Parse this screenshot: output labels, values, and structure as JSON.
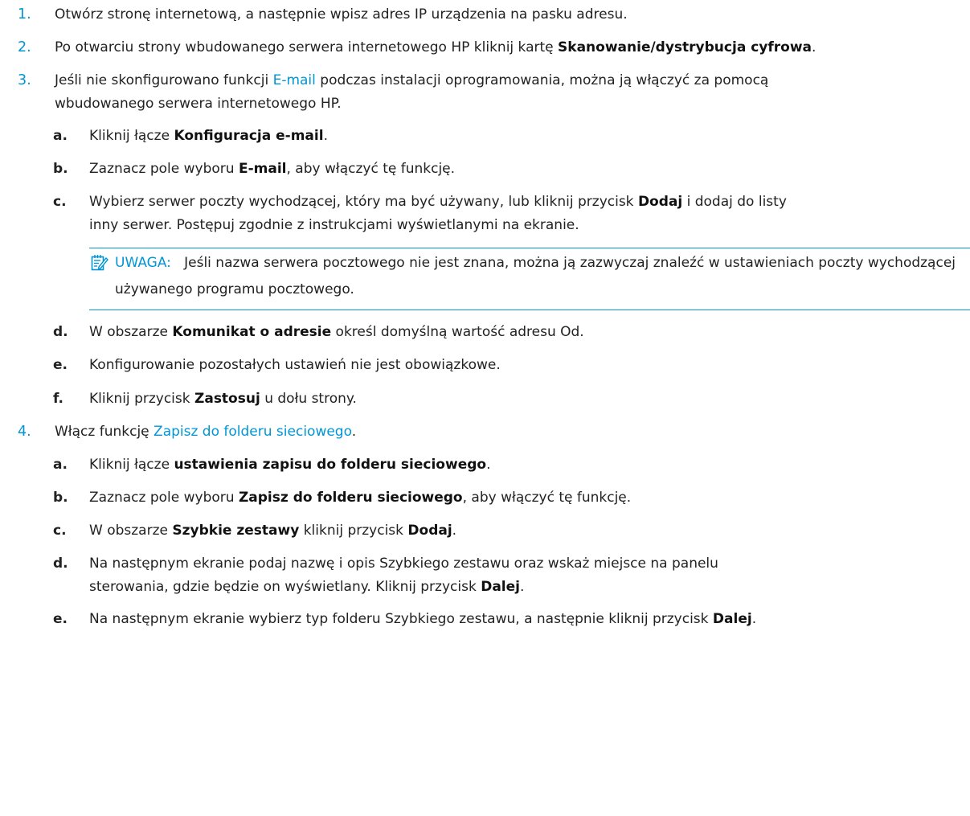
{
  "steps": [
    {
      "num": "1.",
      "text": "Otwórz stronę internetową, a następnie wpisz adres IP urządzenia na pasku adresu."
    },
    {
      "num": "2.",
      "text_a": "Po otwarciu strony wbudowanego serwera internetowego HP kliknij kartę ",
      "bold": "Skanowanie/dystrybucja cyfrowa",
      "text_b": "."
    },
    {
      "num": "3.",
      "text_a": "Jeśli nie skonfigurowano funkcji ",
      "link": "E-mail",
      "text_b": " podczas instalacji oprogramowania, można ją włączyć za pomocą",
      "line2": "wbudowanego serwera internetowego HP."
    },
    {
      "num": "4.",
      "text_a": "Włącz funkcję ",
      "link": "Zapisz do folderu sieciowego",
      "text_b": "."
    }
  ],
  "email_substeps": [
    {
      "num": "a.",
      "text_a": "Kliknij łącze ",
      "bold": "Konfiguracja e-mail",
      "text_b": "."
    },
    {
      "num": "b.",
      "text_a": "Zaznacz pole wyboru ",
      "bold": "E-mail",
      "text_b": ", aby włączyć tę funkcję."
    },
    {
      "num": "c.",
      "text_a": "Wybierz serwer poczty wychodzącej, który ma być używany, lub kliknij przycisk ",
      "bold": "Dodaj",
      "text_b": " i dodaj do listy",
      "line2": "inny serwer. Postępuj zgodnie z instrukcjami wyświetlanymi na ekranie."
    },
    {
      "num": "d.",
      "text_a": "W obszarze ",
      "bold": "Komunikat o adresie",
      "text_b": " określ domyślną wartość adresu Od."
    },
    {
      "num": "e.",
      "text_a": "Konfigurowanie pozostałych ustawień nie jest obowiązkowe.",
      "bold": "",
      "text_b": ""
    },
    {
      "num": "f.",
      "text_a": "Kliknij przycisk ",
      "bold": "Zastosuj",
      "text_b": " u dołu strony."
    }
  ],
  "note": {
    "label": "UWAGA:",
    "text": "Jeśli nazwa serwera pocztowego nie jest znana, można ją zazwyczaj znaleźć w ustawieniach poczty wychodzącej używanego programu pocztowego."
  },
  "folder_substeps": [
    {
      "num": "a.",
      "text_a": "Kliknij łącze ",
      "bold": "ustawienia zapisu do folderu sieciowego",
      "text_b": ".",
      "bold2": "",
      "text_c": ""
    },
    {
      "num": "b.",
      "text_a": "Zaznacz pole wyboru ",
      "bold": "Zapisz do folderu sieciowego",
      "text_b": ", aby włączyć tę funkcję.",
      "bold2": "",
      "text_c": ""
    },
    {
      "num": "c.",
      "text_a": "W obszarze ",
      "bold": "Szybkie zestawy",
      "text_b": " kliknij przycisk ",
      "bold2": "Dodaj",
      "text_c": "."
    },
    {
      "num": "d.",
      "text_a": "Na następnym ekranie podaj nazwę i opis Szybkiego zestawu oraz wskaż miejsce na panelu",
      "line2a": "sterowania, gdzie będzie on wyświetlany. Kliknij przycisk ",
      "bold": "Dalej",
      "text_b": "."
    },
    {
      "num": "e.",
      "text_a": "Na następnym ekranie wybierz typ folderu Szybkiego zestawu, a następnie kliknij przycisk ",
      "bold": "Dalej",
      "text_b": "."
    }
  ],
  "colors": {
    "accent": "#0096d6",
    "text": "#222222"
  },
  "icons": {
    "note": "note-pencil-icon"
  }
}
